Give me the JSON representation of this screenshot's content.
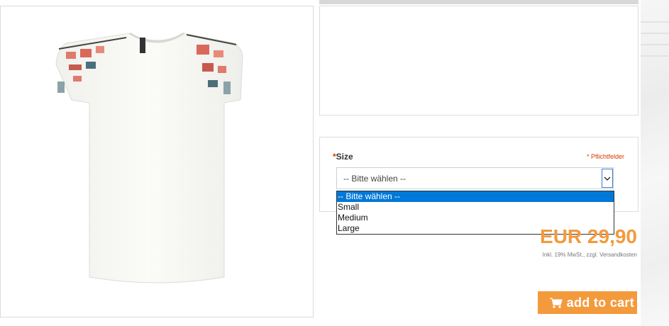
{
  "product": {
    "image_alt": "white embroidered t-shirt"
  },
  "options": {
    "size_label": "Size",
    "required_marker": "*",
    "required_note": "* Pflichtfelder",
    "select_value": "-- Bitte wählen --",
    "dropdown_options": [
      "-- Bitte wählen --",
      "Small",
      "Medium",
      "Large"
    ],
    "selected_index": 0
  },
  "price": {
    "amount": "EUR 29,90",
    "tax_note": "Inkl. 19% MwSt., zzgl. Versandkosten"
  },
  "cart": {
    "button_label": "add to cart",
    "icon": "shopping-cart-icon"
  },
  "colors": {
    "accent": "#f39a3c",
    "required": "#d23c00",
    "highlight": "#0078d7"
  }
}
